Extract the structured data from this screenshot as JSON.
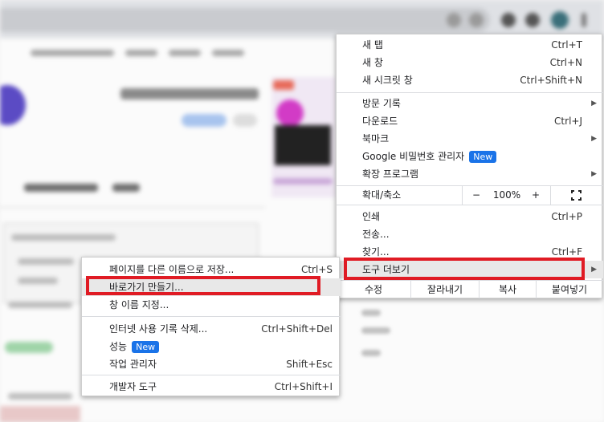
{
  "main_menu": {
    "items": [
      {
        "label": "새 탭",
        "shortcut": "Ctrl+T"
      },
      {
        "label": "새 창",
        "shortcut": "Ctrl+N"
      },
      {
        "label": "새 시크릿 창",
        "shortcut": "Ctrl+Shift+N"
      },
      {
        "label": "방문 기록",
        "shortcut": ""
      },
      {
        "label": "다운로드",
        "shortcut": "Ctrl+J"
      },
      {
        "label": "북마크",
        "shortcut": ""
      },
      {
        "label": "Google 비밀번호 관리자",
        "shortcut": "",
        "badge": "New"
      },
      {
        "label": "확장 프로그램",
        "shortcut": ""
      },
      {
        "label": "인쇄",
        "shortcut": "Ctrl+P"
      },
      {
        "label": "전송...",
        "shortcut": ""
      },
      {
        "label": "찾기...",
        "shortcut": "Ctrl+F"
      },
      {
        "label": "도구 더보기",
        "shortcut": ""
      }
    ],
    "zoom": {
      "label": "확대/축소",
      "minus": "−",
      "value": "100%",
      "plus": "+"
    },
    "edit": {
      "label": "수정",
      "cut": "잘라내기",
      "copy": "복사",
      "paste": "붙여넣기"
    }
  },
  "sub_menu": {
    "items": [
      {
        "label": "페이지를 다른 이름으로 저장...",
        "shortcut": "Ctrl+S"
      },
      {
        "label": "바로가기 만들기...",
        "shortcut": ""
      },
      {
        "label": "창 이름 지정...",
        "shortcut": ""
      },
      {
        "label": "인터넷 사용 기록 삭제...",
        "shortcut": "Ctrl+Shift+Del"
      },
      {
        "label": "성능",
        "shortcut": "",
        "badge": "New"
      },
      {
        "label": "작업 관리자",
        "shortcut": "Shift+Esc"
      },
      {
        "label": "개발자 도구",
        "shortcut": "Ctrl+Shift+I"
      }
    ]
  },
  "colors": {
    "highlight_box": "#e01b24",
    "badge": "#1a73e8"
  }
}
